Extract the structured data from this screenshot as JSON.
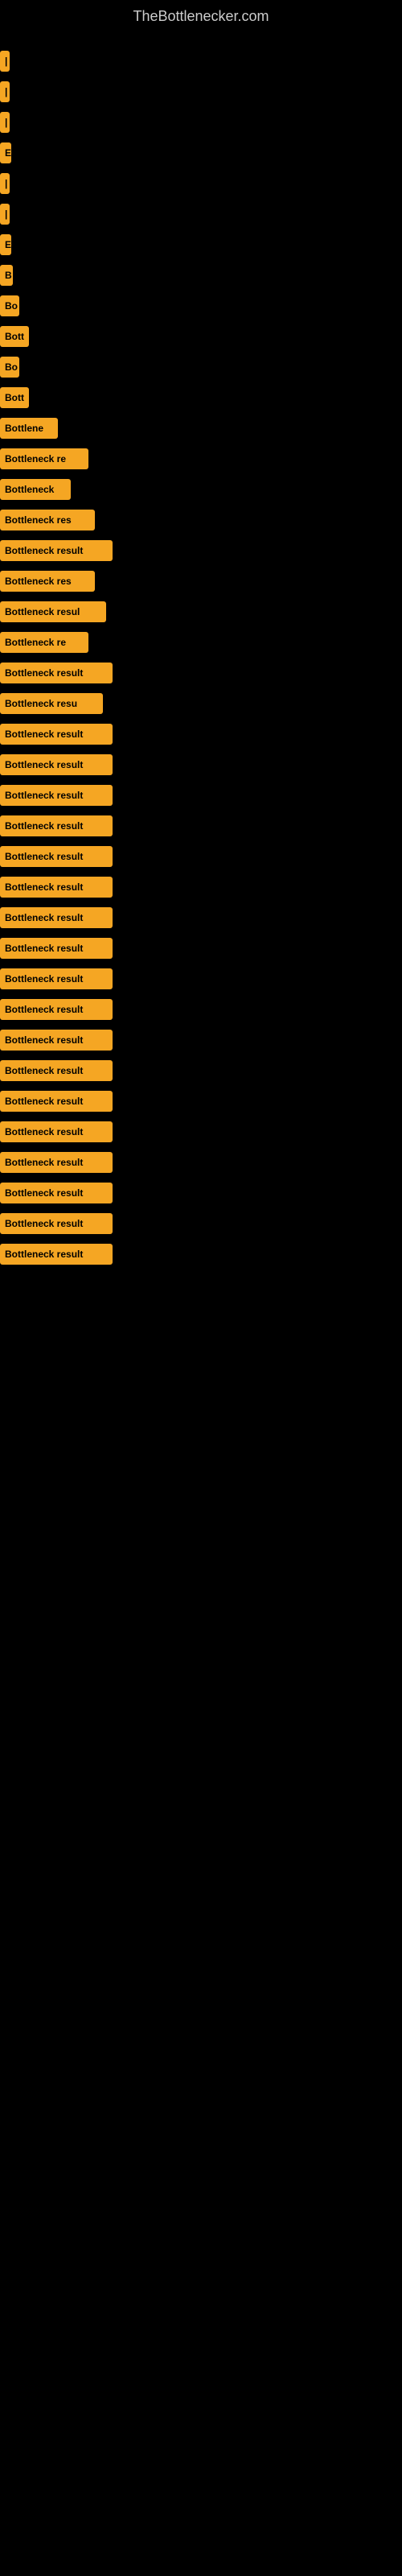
{
  "site": {
    "title": "TheBottlenecker.com"
  },
  "bars": [
    {
      "label": "|",
      "width": 12
    },
    {
      "label": "|",
      "width": 12
    },
    {
      "label": "|",
      "width": 12
    },
    {
      "label": "E",
      "width": 14
    },
    {
      "label": "|",
      "width": 12
    },
    {
      "label": "|",
      "width": 12
    },
    {
      "label": "E",
      "width": 14
    },
    {
      "label": "B",
      "width": 16
    },
    {
      "label": "Bo",
      "width": 24
    },
    {
      "label": "Bott",
      "width": 36
    },
    {
      "label": "Bo",
      "width": 24
    },
    {
      "label": "Bott",
      "width": 36
    },
    {
      "label": "Bottlene",
      "width": 72
    },
    {
      "label": "Bottleneck re",
      "width": 110
    },
    {
      "label": "Bottleneck",
      "width": 88
    },
    {
      "label": "Bottleneck res",
      "width": 118
    },
    {
      "label": "Bottleneck result",
      "width": 140
    },
    {
      "label": "Bottleneck res",
      "width": 118
    },
    {
      "label": "Bottleneck resul",
      "width": 132
    },
    {
      "label": "Bottleneck re",
      "width": 110
    },
    {
      "label": "Bottleneck result",
      "width": 140
    },
    {
      "label": "Bottleneck resu",
      "width": 128
    },
    {
      "label": "Bottleneck result",
      "width": 140
    },
    {
      "label": "Bottleneck result",
      "width": 140
    },
    {
      "label": "Bottleneck result",
      "width": 140
    },
    {
      "label": "Bottleneck result",
      "width": 140
    },
    {
      "label": "Bottleneck result",
      "width": 140
    },
    {
      "label": "Bottleneck result",
      "width": 140
    },
    {
      "label": "Bottleneck result",
      "width": 140
    },
    {
      "label": "Bottleneck result",
      "width": 140
    },
    {
      "label": "Bottleneck result",
      "width": 140
    },
    {
      "label": "Bottleneck result",
      "width": 140
    },
    {
      "label": "Bottleneck result",
      "width": 140
    },
    {
      "label": "Bottleneck result",
      "width": 140
    },
    {
      "label": "Bottleneck result",
      "width": 140
    },
    {
      "label": "Bottleneck result",
      "width": 140
    },
    {
      "label": "Bottleneck result",
      "width": 140
    },
    {
      "label": "Bottleneck result",
      "width": 140
    },
    {
      "label": "Bottleneck result",
      "width": 140
    },
    {
      "label": "Bottleneck result",
      "width": 140
    }
  ]
}
